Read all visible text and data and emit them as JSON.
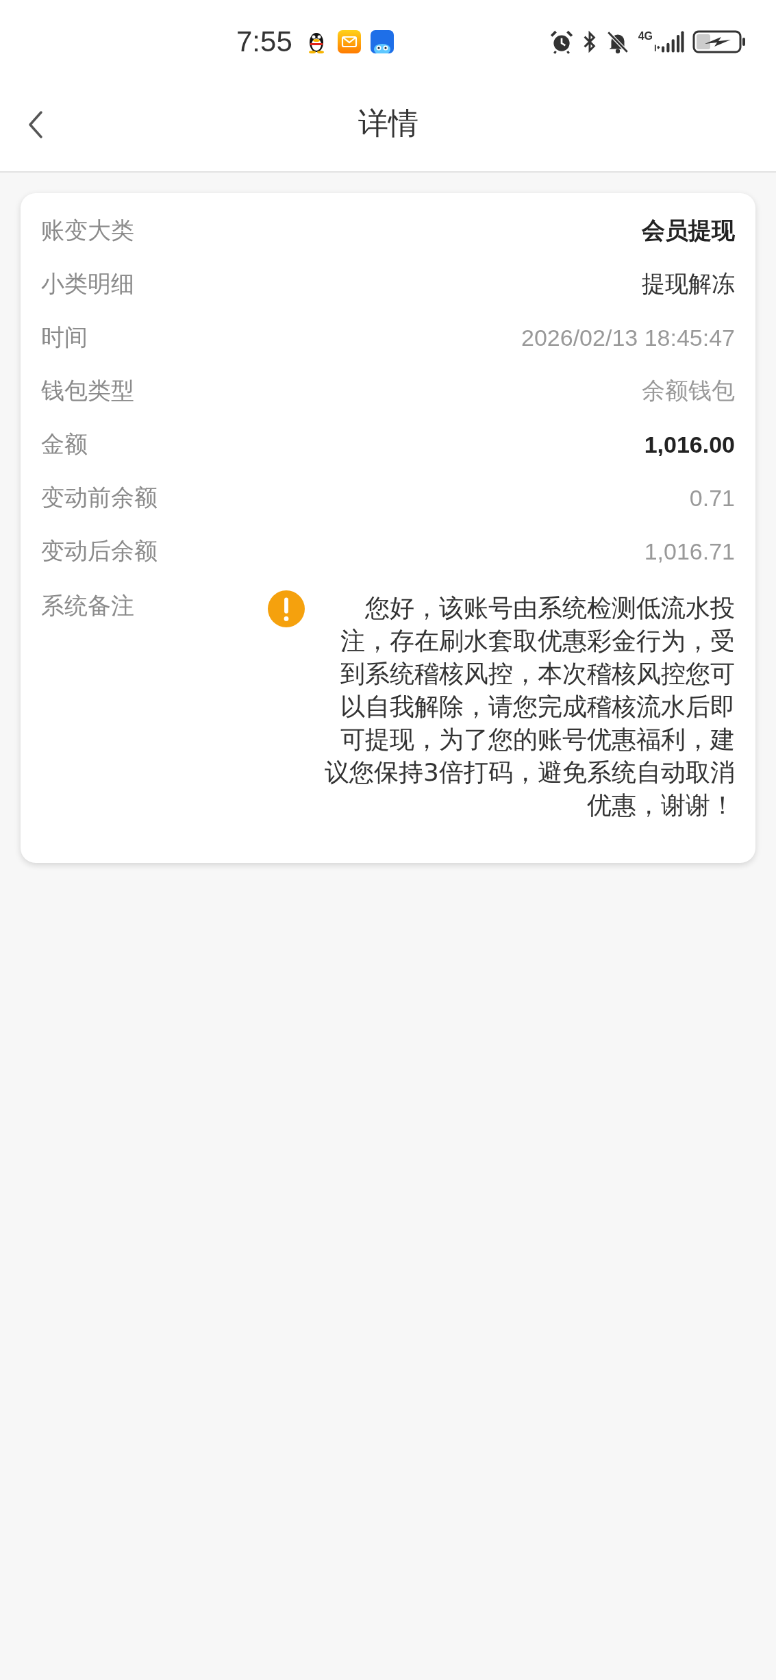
{
  "status_bar": {
    "time": "7:55",
    "network": "4G"
  },
  "header": {
    "title": "详情"
  },
  "details": [
    {
      "label": "账变大类",
      "value": "会员提现",
      "kind": "bold"
    },
    {
      "label": "小类明细",
      "value": "提现解冻",
      "kind": "plain"
    },
    {
      "label": "时间",
      "value": "2026/02/13 18:45:47",
      "kind": "muted"
    },
    {
      "label": "钱包类型",
      "value": "余额钱包",
      "kind": "muted"
    },
    {
      "label": "金额",
      "value": "1,016.00",
      "kind": "bold"
    },
    {
      "label": "变动前余额",
      "value": "0.71",
      "kind": "muted"
    },
    {
      "label": "变动后余额",
      "value": "1,016.71",
      "kind": "muted"
    },
    {
      "label": "系统备注",
      "value": "您好，该账号由系统检测低流水投注，存在刷水套取优惠彩金行为，受到系统稽核风控，本次稽核风控您可以自我解除，请您完成稽核流水后即可提现，为了您的账号优惠福利，建议您保持3倍打码，避免系统自动取消优惠，谢谢！",
      "kind": "note"
    }
  ]
}
